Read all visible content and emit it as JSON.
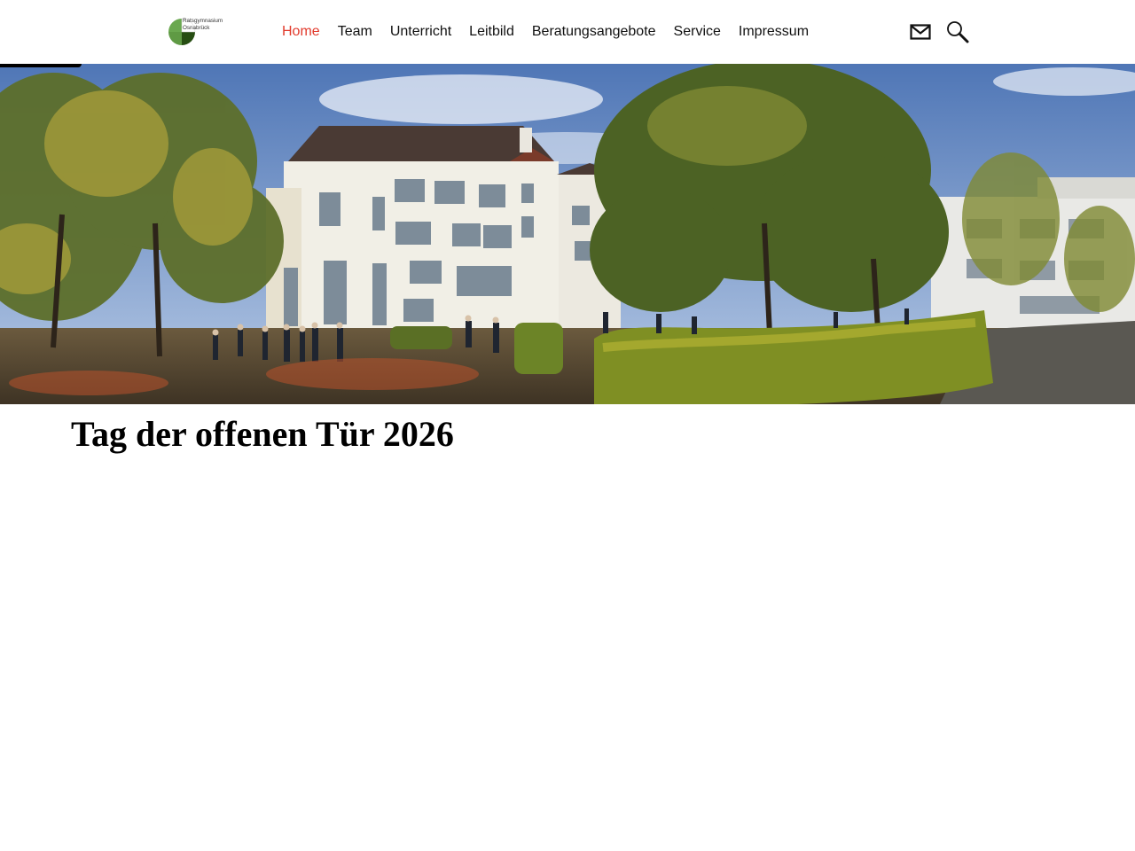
{
  "site": {
    "logo_line1": "Ratsgymnasium",
    "logo_line2": "Osnabrück",
    "logo_icon": "school-logo-icon"
  },
  "nav": {
    "items": [
      {
        "label": "Home",
        "active": true
      },
      {
        "label": "Team",
        "active": false
      },
      {
        "label": "Unterricht",
        "active": false
      },
      {
        "label": "Leitbild",
        "active": false
      },
      {
        "label": "Beratungsangebote",
        "active": false
      },
      {
        "label": "Service",
        "active": false
      },
      {
        "label": "Impressum",
        "active": false
      }
    ]
  },
  "tools": {
    "mail_icon": "mail-icon",
    "search_icon": "search-icon"
  },
  "colors": {
    "nav_active": "#e1392b",
    "logo_green_light": "#6aa84f",
    "logo_green_dark": "#274e13"
  },
  "main": {
    "title": "Tag der offenen Tür 2026"
  }
}
